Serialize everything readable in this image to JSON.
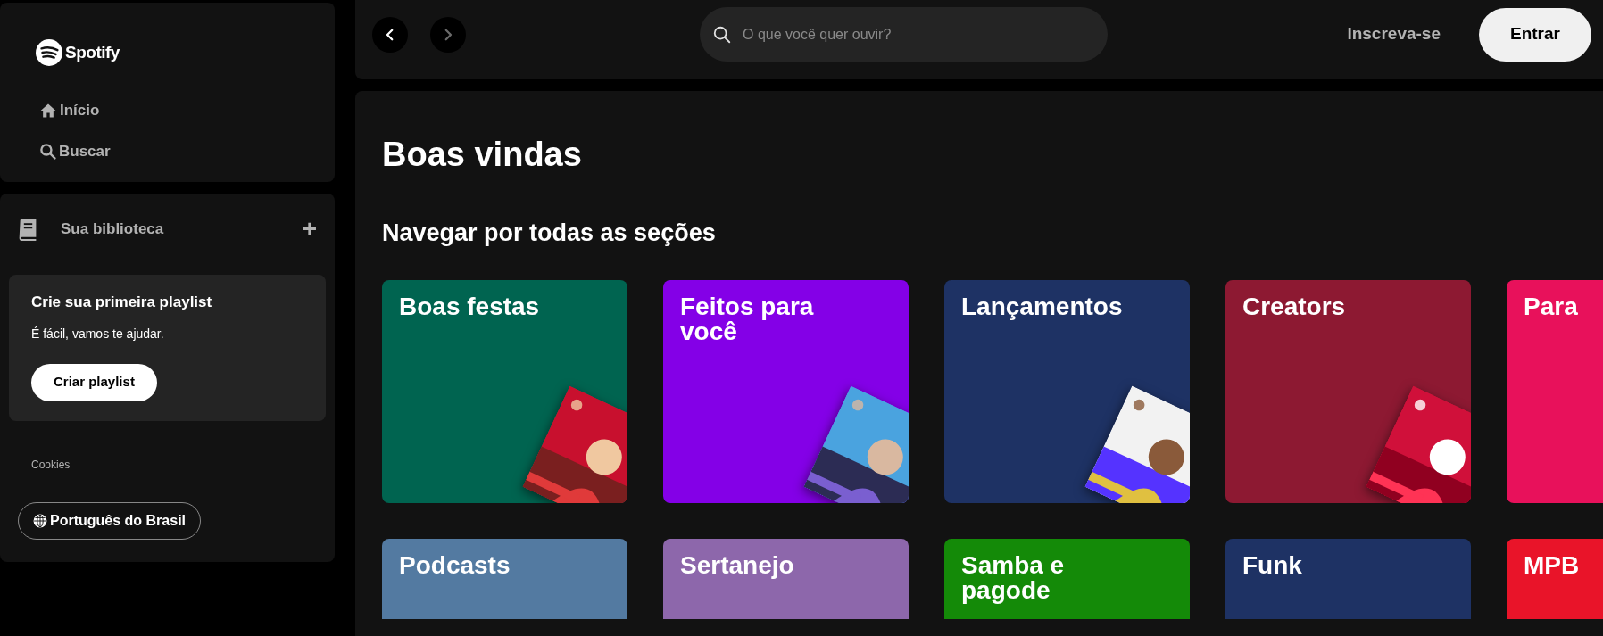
{
  "sidebar": {
    "logo": "Spotify",
    "nav": [
      {
        "label": "Início",
        "kind": "home"
      },
      {
        "label": "Buscar",
        "kind": "search"
      }
    ],
    "library": {
      "title": "Sua biblioteca",
      "add": "+",
      "prompt": {
        "title": "Crie sua primeira playlist",
        "text": "É fácil, vamos te ajudar.",
        "button": "Criar playlist"
      },
      "cookies": "Cookies",
      "language": "Português do Brasil"
    }
  },
  "topbar": {
    "back": {
      "disabled": false
    },
    "forward": {
      "disabled": true
    },
    "search": {
      "placeholder": "O que você quer ouvir?"
    },
    "signup": "Inscreva-se",
    "login": "Entrar"
  },
  "main": {
    "title": "Boas vindas",
    "section": "Navegar por todas as seções",
    "rows": [
      {
        "cards": [
          {
            "title": "Boas festas",
            "color": "#006450",
            "cover": true
          },
          {
            "title": "Feitos para você",
            "color": "#8400e7",
            "cover": true
          },
          {
            "title": "Lançamentos",
            "color": "#1e3264",
            "cover": true
          },
          {
            "title": "Creators",
            "color": "#8d1932",
            "cover": true
          },
          {
            "title": "Para",
            "color": "#e8115b",
            "cover": false
          }
        ]
      },
      {
        "cards": [
          {
            "title": "Podcasts",
            "color": "#537aa1",
            "cover": false
          },
          {
            "title": "Sertanejo",
            "color": "#8d67ab",
            "cover": false
          },
          {
            "title": "Samba e pagode",
            "color": "#148a08",
            "cover": false
          },
          {
            "title": "Funk",
            "color": "#1e3264",
            "cover": false
          },
          {
            "title": "MPB",
            "color": "#e91429",
            "cover": false
          }
        ]
      }
    ]
  }
}
